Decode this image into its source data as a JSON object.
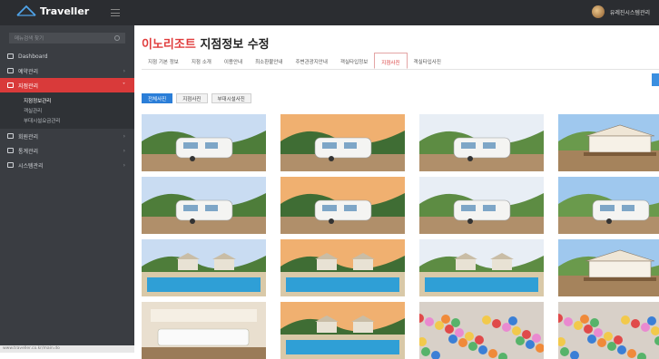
{
  "header": {
    "logo_text": "Traveller",
    "user_name": "유레진시스템관리",
    "colors": {
      "topbar": "#2b2d31",
      "accent": "#d93a3a"
    }
  },
  "sidebar": {
    "search_placeholder": "메뉴검색 찾기",
    "items": [
      {
        "label": "Dashboard",
        "icon": "dashboard-icon"
      },
      {
        "label": "예약관리",
        "icon": "reservation-icon"
      },
      {
        "label": "지점관리",
        "icon": "branch-icon",
        "active": true
      },
      {
        "label": "회원관리",
        "icon": "member-icon"
      },
      {
        "label": "통계관리",
        "icon": "stats-icon"
      },
      {
        "label": "시스템관리",
        "icon": "system-icon"
      }
    ],
    "sub_items": [
      "지점정보관리",
      "객실관리",
      "부대시설요금관리"
    ],
    "status_text": "www.traveller.co.kr/main.do"
  },
  "page": {
    "title_accent": "이노리조트",
    "title_rest": "지점정보 수정",
    "tabs": [
      "지점 기본 정보",
      "지점 소개",
      "이용안내",
      "최소환불안내",
      "주변관광지안내",
      "객실타입정보",
      "지점사진",
      "객실타입사진"
    ],
    "active_tab": "지점사진",
    "filters": [
      "전체사진",
      "지점사진",
      "부대시설사진"
    ],
    "active_filter": "전체사진"
  },
  "photos": [
    {
      "subject": "caravan-icon"
    },
    {
      "subject": "caravan-icon"
    },
    {
      "subject": "caravan-icon"
    },
    {
      "subject": "glamping-icon"
    },
    {
      "subject": "caravan-icon"
    },
    {
      "subject": "caravan-icon"
    },
    {
      "subject": "caravan-icon"
    },
    {
      "subject": "caravan-icon"
    },
    {
      "subject": "pool-icon"
    },
    {
      "subject": "pool-icon"
    },
    {
      "subject": "pool-icon"
    },
    {
      "subject": "glamping-icon"
    },
    {
      "subject": "lounge-icon"
    },
    {
      "subject": "pool-icon"
    },
    {
      "subject": "playroom-icon"
    },
    {
      "subject": "playroom-icon"
    }
  ]
}
